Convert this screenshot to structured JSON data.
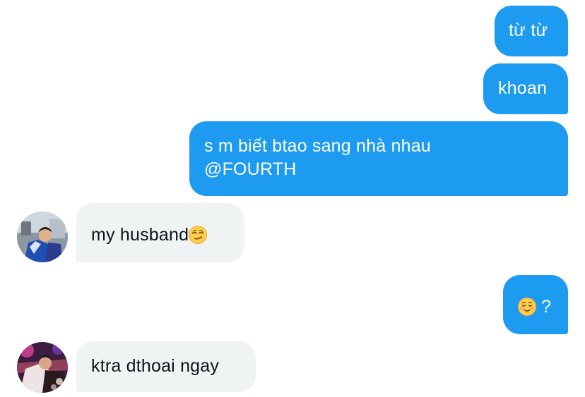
{
  "conversation": {
    "messages": [
      {
        "direction": "outgoing",
        "text": "từ từ"
      },
      {
        "direction": "outgoing",
        "text": "khoan"
      },
      {
        "direction": "outgoing",
        "text": "s m biết btao sang nhà nhau"
      },
      {
        "direction": "outgoing",
        "text": "@FOURTH"
      },
      {
        "direction": "incoming",
        "text": "my husband",
        "emoji": "smirking-face"
      },
      {
        "direction": "outgoing",
        "text": "?",
        "emoji": "relieved-smiling-face"
      },
      {
        "direction": "incoming",
        "text": "ktra dthoai ngay"
      }
    ]
  },
  "colors": {
    "outgoing_bubble": "#1d9bf0",
    "incoming_bubble": "#eff3f4",
    "outgoing_text": "#ffffff",
    "incoming_text": "#0f1419"
  }
}
